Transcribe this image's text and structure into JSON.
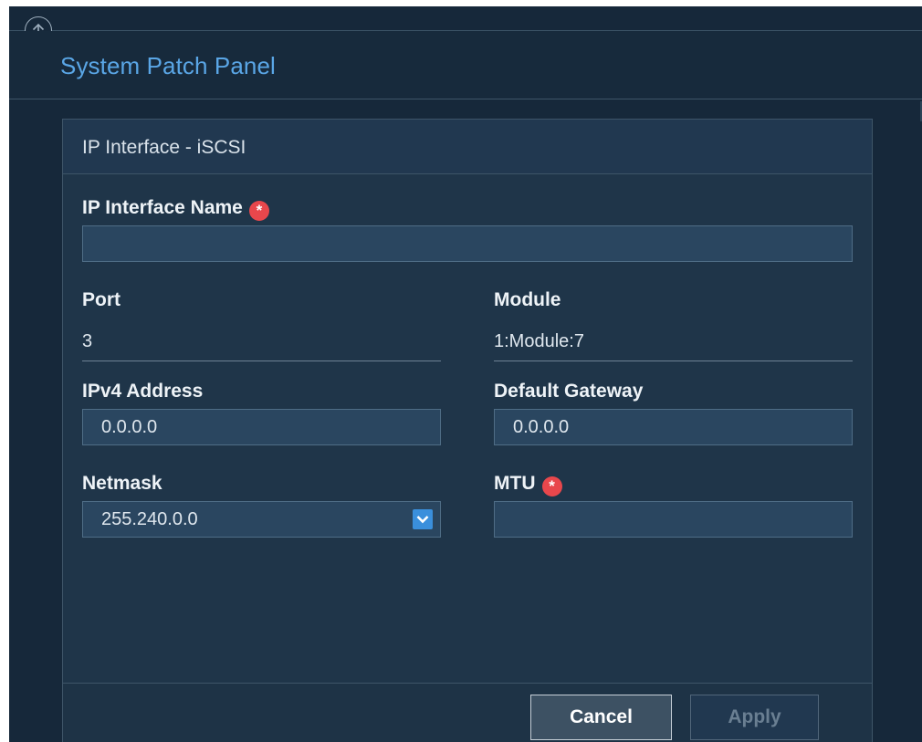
{
  "header": {
    "title": "System Patch Panel"
  },
  "panel": {
    "title": "IP Interface - iSCSI"
  },
  "form": {
    "ip_interface_name": {
      "label": "IP Interface Name",
      "value": "",
      "required": true
    },
    "port": {
      "label": "Port",
      "value": "3"
    },
    "module": {
      "label": "Module",
      "value": "1:Module:7"
    },
    "ipv4_address": {
      "label": "IPv4 Address",
      "value": "0.0.0.0"
    },
    "default_gateway": {
      "label": "Default Gateway",
      "value": "0.0.0.0"
    },
    "netmask": {
      "label": "Netmask",
      "value": "255.240.0.0"
    },
    "mtu": {
      "label": "MTU",
      "value": "",
      "required": true
    }
  },
  "footer": {
    "cancel_label": "Cancel",
    "apply_label": "Apply"
  },
  "icons": {
    "back": "up-arrow-circle-icon",
    "required": "asterisk-icon",
    "dropdown": "chevron-down-icon"
  },
  "colors": {
    "background": "#16283a",
    "panel": "#1f3549",
    "title_accent": "#5aa6e6",
    "required": "#e8474c",
    "dropdown_accent": "#3a8fdc"
  }
}
